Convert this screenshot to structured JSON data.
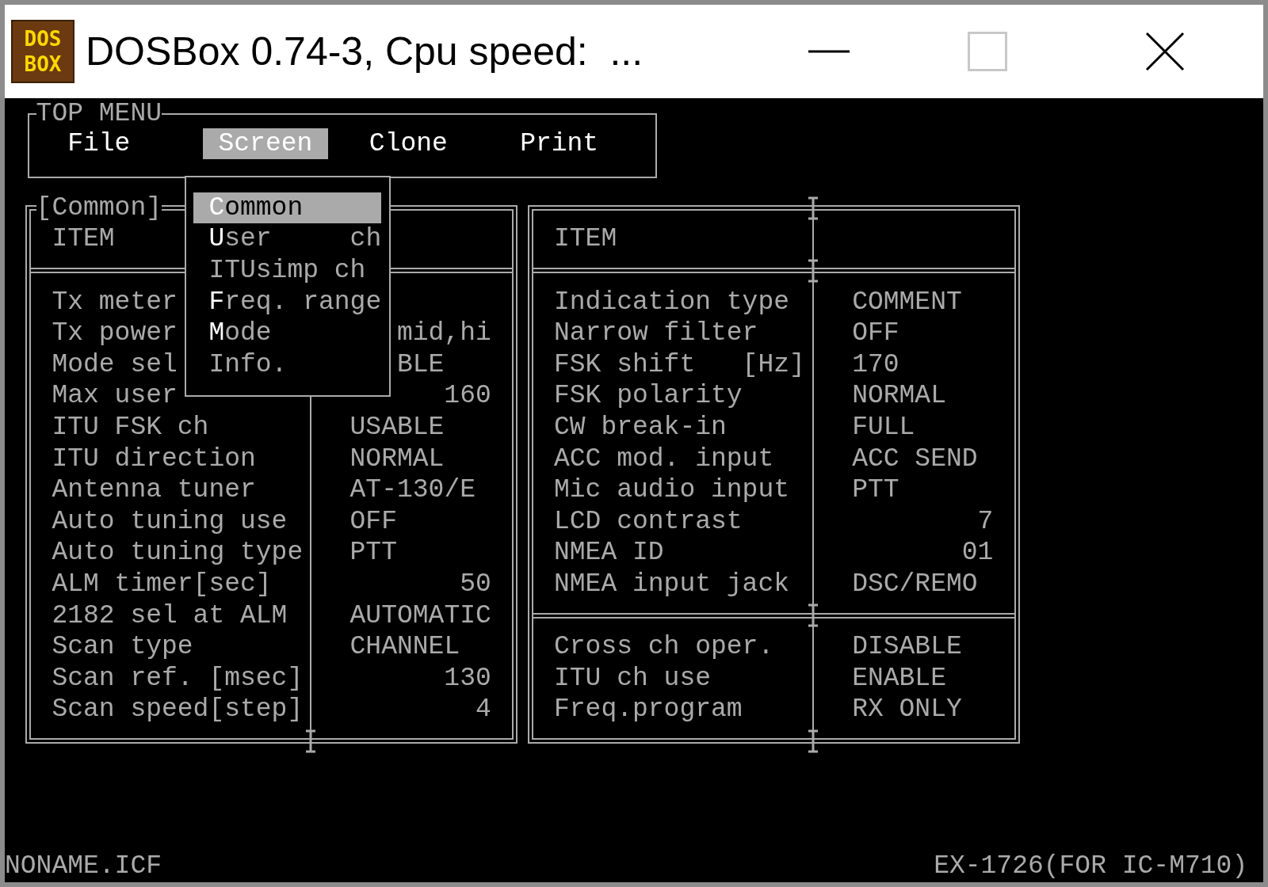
{
  "window": {
    "title": "DOSBox 0.74-3, Cpu speed:  ...",
    "logo": [
      "DOS",
      "BOX"
    ]
  },
  "top_menu": {
    "title": "TOP MENU",
    "items": [
      {
        "label": "File",
        "selected": false
      },
      {
        "label": "Screen",
        "selected": true
      },
      {
        "label": "Clone",
        "selected": false
      },
      {
        "label": "Print",
        "selected": false
      }
    ]
  },
  "dropdown": {
    "items": [
      {
        "label": "Common",
        "selected": true,
        "hotkey": true
      },
      {
        "label": "User     ch",
        "selected": false,
        "hotkey": true
      },
      {
        "label": "ITUsimp ch",
        "selected": false,
        "hotkey": false
      },
      {
        "label": "Freq. range",
        "selected": false,
        "hotkey": true
      },
      {
        "label": "Mode",
        "selected": false,
        "hotkey": true
      },
      {
        "label": "Info.",
        "selected": false,
        "hotkey": false
      }
    ]
  },
  "panels": [
    {
      "title": "[Common]",
      "header": "ITEM",
      "sections": [
        {
          "rows": [
            {
              "label": "Tx meter"
            },
            {
              "label": "Tx power",
              "value": "mid,hi",
              "kind": "text",
              "covered": true
            },
            {
              "label": "Mode sel",
              "value": "BLE",
              "kind": "text",
              "covered": true
            },
            {
              "label": "Max user",
              "value": "160",
              "kind": "number"
            },
            {
              "label": "ITU FSK ch",
              "value": "USABLE",
              "kind": "text",
              "covered": false
            },
            {
              "label": "ITU direction",
              "value": "NORMAL",
              "kind": "text",
              "covered": false
            },
            {
              "label": "Antenna tuner",
              "value": "AT-130/E",
              "kind": "text",
              "covered": false
            },
            {
              "label": "Auto tuning use",
              "value": "OFF",
              "kind": "text",
              "covered": false
            },
            {
              "label": "Auto tuning type",
              "value": "PTT",
              "kind": "text",
              "covered": false
            },
            {
              "label": "ALM timer[sec]",
              "value": "50",
              "kind": "number"
            },
            {
              "label": "2182 sel at ALM",
              "value": "AUTOMATIC",
              "kind": "text",
              "covered": false
            },
            {
              "label": "Scan type",
              "value": "CHANNEL",
              "kind": "text",
              "covered": false
            },
            {
              "label": "Scan ref. [msec]",
              "value": "130",
              "kind": "number"
            },
            {
              "label": "Scan speed[step]",
              "value": "4",
              "kind": "number"
            }
          ]
        }
      ]
    },
    {
      "header": "ITEM",
      "sections": [
        {
          "rows": [
            {
              "label": "Indication type",
              "value": "COMMENT",
              "kind": "text",
              "covered": false
            },
            {
              "label": "Narrow filter",
              "value": "OFF",
              "kind": "text",
              "covered": false
            },
            {
              "label": "FSK shift   [Hz]",
              "value": "170",
              "kind": "text",
              "covered": false
            },
            {
              "label": "FSK polarity",
              "value": "NORMAL",
              "kind": "text",
              "covered": false
            },
            {
              "label": "CW break-in",
              "value": "FULL",
              "kind": "text",
              "covered": false
            },
            {
              "label": "ACC mod. input",
              "value": "ACC SEND",
              "kind": "text",
              "covered": false
            },
            {
              "label": "Mic audio input",
              "value": "PTT",
              "kind": "text",
              "covered": false
            },
            {
              "label": "LCD contrast",
              "value": "7",
              "kind": "number"
            },
            {
              "label": "NMEA ID",
              "value": "01",
              "kind": "number"
            },
            {
              "label": "NMEA input jack",
              "value": "DSC/REMO",
              "kind": "text",
              "covered": false
            }
          ]
        },
        {
          "rows": [
            {
              "label": "Cross ch oper.",
              "value": "DISABLE",
              "kind": "text",
              "covered": false
            },
            {
              "label": "ITU ch use",
              "value": "ENABLE",
              "kind": "text",
              "covered": false
            },
            {
              "label": "Freq.program",
              "value": "RX ONLY",
              "kind": "text",
              "covered": false
            }
          ]
        }
      ]
    }
  ],
  "status_bar": {
    "file": "NONAME.ICF",
    "model": "EX-1726(FOR IC-M710)"
  }
}
